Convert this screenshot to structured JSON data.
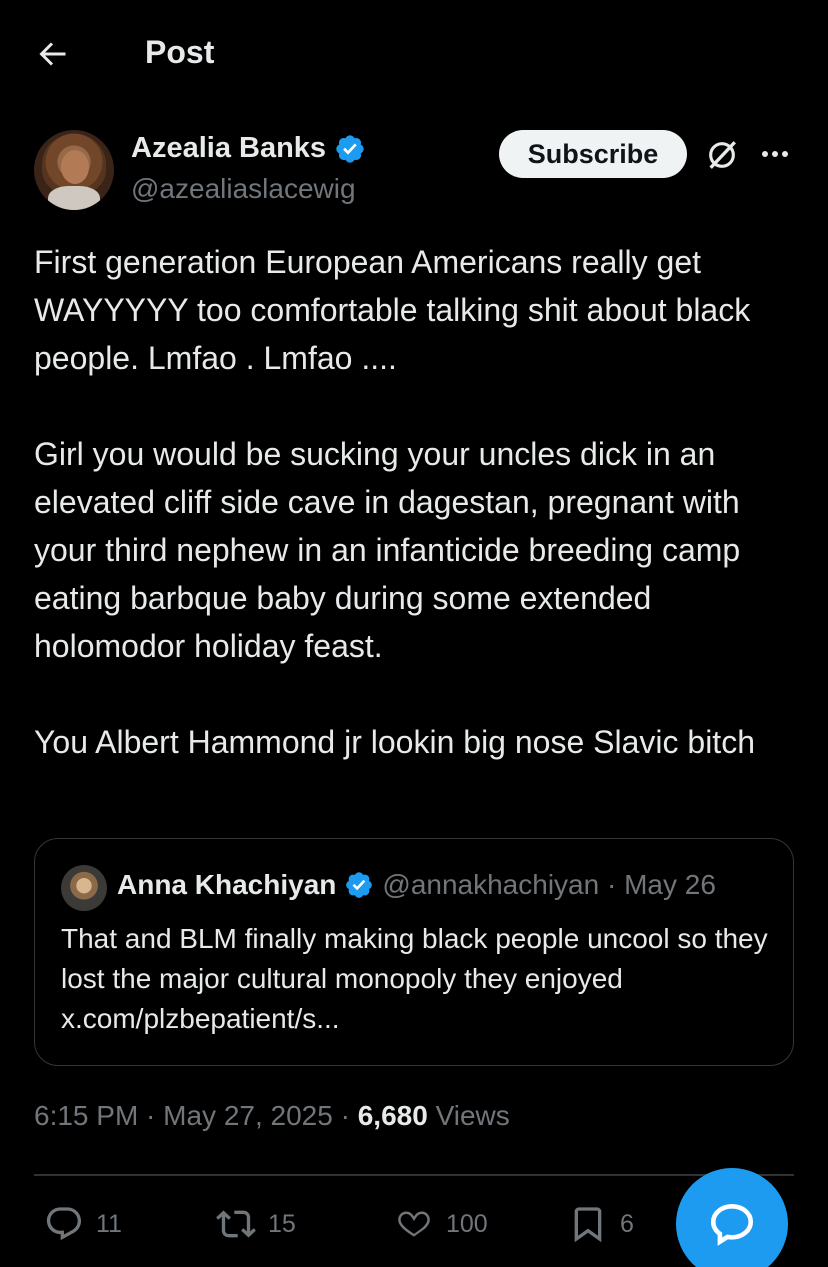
{
  "header": {
    "title": "Post",
    "back_icon": "arrow-left-icon"
  },
  "author": {
    "name": "Azealia Banks",
    "handle": "@azealiaslacewig",
    "verified": true,
    "verified_color": "#1d9bf0"
  },
  "actions_top": {
    "subscribe_label": "Subscribe",
    "grok_icon": "grok-icon",
    "more_icon": "more-icon"
  },
  "tweet": {
    "text": "First generation European Americans really get WAYYYYY too comfortable talking shit about black people. Lmfao . Lmfao ....\n\nGirl you would be sucking your uncles dick in an elevated cliff side cave in dagestan, pregnant with your third nephew in an infanticide breeding camp eating barbque baby during some extended holomodor holiday feast.\n\nYou Albert Hammond jr lookin big nose Slavic bitch"
  },
  "quote": {
    "name": "Anna Khachiyan",
    "handle_date": "@annakhachiyan · May 26",
    "text": "That and BLM finally making black people uncool so they lost the major cultural monopoly they enjoyed x.com/plzbepatient/s..."
  },
  "meta": {
    "time_date": "6:15 PM · May 27, 2025 · ",
    "views_count": "6,680",
    "views_label": " Views"
  },
  "engagement": {
    "replies": "11",
    "reposts": "15",
    "likes": "100",
    "bookmarks": "6"
  },
  "colors": {
    "background": "#000000",
    "text": "#e7e9ea",
    "muted": "#71767b",
    "accent": "#1d9bf0"
  }
}
